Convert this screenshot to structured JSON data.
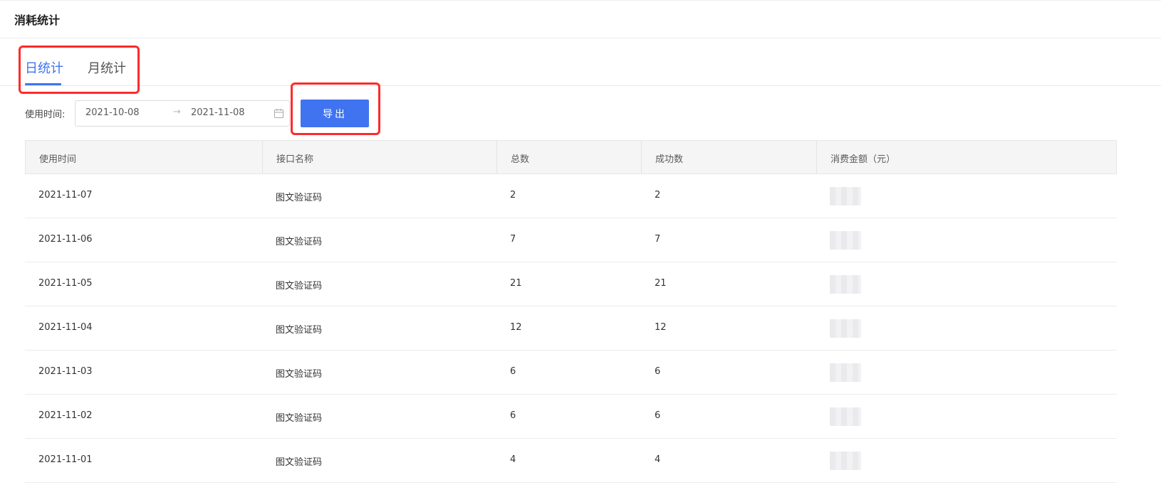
{
  "header": {
    "title": "消耗统计"
  },
  "tabs": [
    {
      "label": "日统计",
      "active": true
    },
    {
      "label": "月统计",
      "active": false
    }
  ],
  "filter": {
    "label": "使用时间:",
    "start_date": "2021-10-08",
    "separator": "→",
    "end_date": "2021-11-08",
    "icon": "calendar-icon"
  },
  "export_button": {
    "label": "导出"
  },
  "table": {
    "columns": [
      "使用时间",
      "接口名称",
      "总数",
      "成功数",
      "消费金额（元）"
    ],
    "rows": [
      {
        "date": "2021-11-07",
        "api": "图文验证码",
        "total": "2",
        "success": "2"
      },
      {
        "date": "2021-11-06",
        "api": "图文验证码",
        "total": "7",
        "success": "7"
      },
      {
        "date": "2021-11-05",
        "api": "图文验证码",
        "total": "21",
        "success": "21"
      },
      {
        "date": "2021-11-04",
        "api": "图文验证码",
        "total": "12",
        "success": "12"
      },
      {
        "date": "2021-11-03",
        "api": "图文验证码",
        "total": "6",
        "success": "6"
      },
      {
        "date": "2021-11-02",
        "api": "图文验证码",
        "total": "6",
        "success": "6"
      },
      {
        "date": "2021-11-01",
        "api": "图文验证码",
        "total": "4",
        "success": "4"
      }
    ]
  },
  "colors": {
    "accent": "#3f73f0",
    "highlight": "#ff2a2a",
    "header_bg": "#f5f5f5"
  }
}
